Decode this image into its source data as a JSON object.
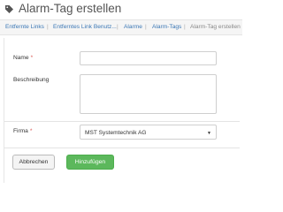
{
  "header": {
    "title": "Alarm-Tag erstellen",
    "icon": "tag-icon"
  },
  "breadcrumb": {
    "items": [
      {
        "label": "Entfernte Links"
      },
      {
        "label": "Entferntes Link Benutz..."
      },
      {
        "label": "Alarme"
      },
      {
        "label": "Alarm-Tags"
      },
      {
        "label": "Alarm-Tag erstellen"
      }
    ],
    "separator": "|"
  },
  "form": {
    "name": {
      "label": "Name",
      "required_mark": "*",
      "value": "",
      "placeholder": ""
    },
    "description": {
      "label": "Beschreibung",
      "value": ""
    },
    "company": {
      "label": "Firma",
      "required_mark": "*",
      "selected": "MST Systemtechnik AG"
    }
  },
  "actions": {
    "cancel_label": "Abbrechen",
    "submit_label": "Hinzufügen"
  },
  "colors": {
    "accent": "#5cb85c",
    "link": "#3b77b5",
    "required": "#d9534f"
  }
}
